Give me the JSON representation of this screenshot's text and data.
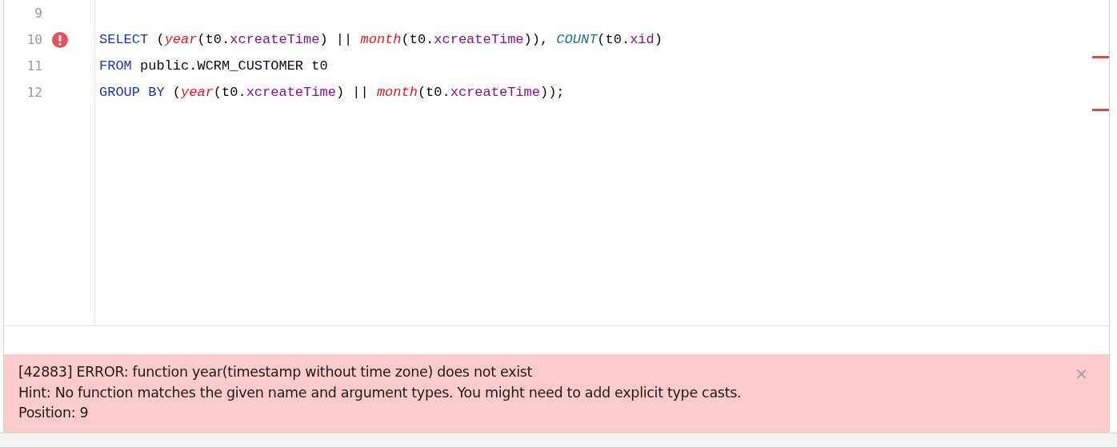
{
  "editor": {
    "lines": [
      {
        "number": "9",
        "error": false
      },
      {
        "number": "10",
        "error": true,
        "tokens": [
          {
            "kind": "keyword",
            "text": "SELECT"
          },
          {
            "kind": "plain",
            "text": " ("
          },
          {
            "kind": "function",
            "text": "year"
          },
          {
            "kind": "plain",
            "text": "(t0."
          },
          {
            "kind": "field",
            "text": "xcreateTime"
          },
          {
            "kind": "plain",
            "text": ") || "
          },
          {
            "kind": "function",
            "text": "month"
          },
          {
            "kind": "plain",
            "text": "(t0."
          },
          {
            "kind": "field",
            "text": "xcreateTime"
          },
          {
            "kind": "plain",
            "text": ")), "
          },
          {
            "kind": "aggregate",
            "text": "COUNT"
          },
          {
            "kind": "plain",
            "text": "(t0."
          },
          {
            "kind": "field",
            "text": "xid"
          },
          {
            "kind": "plain",
            "text": ")"
          }
        ]
      },
      {
        "number": "11",
        "error": false,
        "tokens": [
          {
            "kind": "keyword",
            "text": "FROM"
          },
          {
            "kind": "plain",
            "text": " public.WCRM_CUSTOMER t0"
          }
        ]
      },
      {
        "number": "12",
        "error": false,
        "tokens": [
          {
            "kind": "keyword",
            "text": "GROUP BY"
          },
          {
            "kind": "plain",
            "text": " ("
          },
          {
            "kind": "function",
            "text": "year"
          },
          {
            "kind": "plain",
            "text": "(t0."
          },
          {
            "kind": "field",
            "text": "xcreateTime"
          },
          {
            "kind": "plain",
            "text": ") || "
          },
          {
            "kind": "function",
            "text": "month"
          },
          {
            "kind": "plain",
            "text": "(t0."
          },
          {
            "kind": "field",
            "text": "xcreateTime"
          },
          {
            "kind": "plain",
            "text": "));"
          }
        ]
      }
    ]
  },
  "error_panel": {
    "lines": [
      "[42883] ERROR: function year(timestamp without time zone) does not exist",
      "Hint: No function matches the given name and argument types. You might need to add explicit type casts.",
      "Position: 9"
    ],
    "close": "×"
  }
}
